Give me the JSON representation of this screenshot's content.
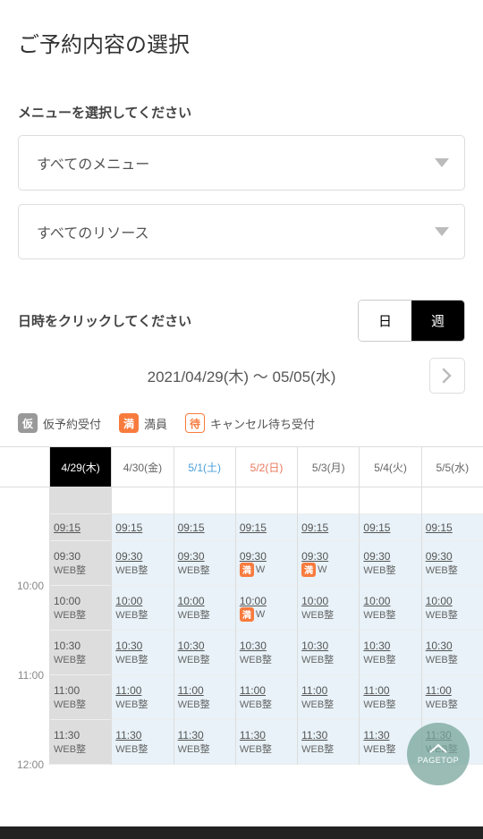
{
  "page_title": "ご予約内容の選択",
  "menu_label": "メニューを選択してください",
  "menu_select": "すべてのメニュー",
  "resource_select": "すべてのリソース",
  "date_label": "日時をクリックしてください",
  "view_day": "日",
  "view_week": "週",
  "date_range": "2021/04/29(木) 〜 05/05(水)",
  "legend": {
    "kari_badge": "仮",
    "kari_text": "仮予約受付",
    "man_badge": "満",
    "man_text": "満員",
    "machi_badge": "待",
    "machi_text": "キャンセル待ち受付"
  },
  "time_labels": [
    "10:00",
    "11:00",
    "12:00"
  ],
  "days": [
    {
      "label": "4/29(木)",
      "cls": "today"
    },
    {
      "label": "4/30(金)",
      "cls": ""
    },
    {
      "label": "5/1(土)",
      "cls": "sat"
    },
    {
      "label": "5/2(日)",
      "cls": "sun"
    },
    {
      "label": "5/3(月)",
      "cls": ""
    },
    {
      "label": "5/4(火)",
      "cls": ""
    },
    {
      "label": "5/5(水)",
      "cls": ""
    }
  ],
  "slot_text": "WEB整",
  "slot_text_w": "W",
  "man_char": "満",
  "rows": [
    {
      "type": "mini",
      "time": "09:15",
      "cells": [
        {
          "d": true
        },
        {
          "d": false
        },
        {
          "d": false
        },
        {
          "d": false
        },
        {
          "d": false
        },
        {
          "d": false
        },
        {
          "d": false
        }
      ]
    },
    {
      "type": "full",
      "time": "09:30",
      "cells": [
        {
          "d": true,
          "full": false
        },
        {
          "d": false,
          "full": false
        },
        {
          "d": false,
          "full": false
        },
        {
          "d": false,
          "full": true
        },
        {
          "d": false,
          "full": true
        },
        {
          "d": false,
          "full": false
        },
        {
          "d": false,
          "full": false
        }
      ]
    },
    {
      "type": "full",
      "time": "10:00",
      "cells": [
        {
          "d": true,
          "full": false
        },
        {
          "d": false,
          "full": false
        },
        {
          "d": false,
          "full": false
        },
        {
          "d": false,
          "full": true
        },
        {
          "d": false,
          "full": false
        },
        {
          "d": false,
          "full": false
        },
        {
          "d": false,
          "full": false
        }
      ]
    },
    {
      "type": "full",
      "time": "10:30",
      "cells": [
        {
          "d": true,
          "full": false
        },
        {
          "d": false,
          "full": false
        },
        {
          "d": false,
          "full": false
        },
        {
          "d": false,
          "full": false
        },
        {
          "d": false,
          "full": false
        },
        {
          "d": false,
          "full": false
        },
        {
          "d": false,
          "full": false
        }
      ]
    },
    {
      "type": "full",
      "time": "11:00",
      "cells": [
        {
          "d": true,
          "full": false
        },
        {
          "d": false,
          "full": false
        },
        {
          "d": false,
          "full": false
        },
        {
          "d": false,
          "full": false
        },
        {
          "d": false,
          "full": false
        },
        {
          "d": false,
          "full": false
        },
        {
          "d": false,
          "full": false
        }
      ]
    },
    {
      "type": "full",
      "time": "11:30",
      "cells": [
        {
          "d": true,
          "full": false
        },
        {
          "d": false,
          "full": false
        },
        {
          "d": false,
          "full": false
        },
        {
          "d": false,
          "full": false
        },
        {
          "d": false,
          "full": false
        },
        {
          "d": false,
          "full": false
        },
        {
          "d": false,
          "full": false
        }
      ]
    }
  ],
  "pagetop": "PAGETOP"
}
